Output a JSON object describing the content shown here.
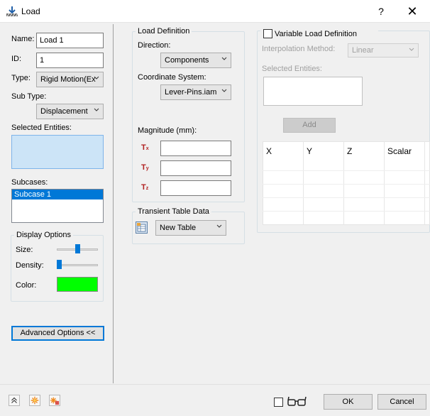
{
  "window": {
    "title": "Load",
    "help_label": "?",
    "close_label": "✕"
  },
  "left": {
    "name_label": "Name:",
    "name_value": "Load 1",
    "id_label": "ID:",
    "id_value": "1",
    "type_label": "Type:",
    "type_value": "Rigid Motion(Ex",
    "subtype_label": "Sub Type:",
    "subtype_value": "Displacement",
    "selected_entities_label": "Selected Entities:",
    "subcases_label": "Subcases:",
    "subcases": [
      "Subcase 1"
    ],
    "display_options": {
      "title": "Display Options",
      "size_label": "Size:",
      "size_level": 0.5,
      "density_label": "Density:",
      "density_level": 0.0,
      "color_label": "Color:",
      "color_value": "#00ff00"
    },
    "advanced_button": "Advanced Options <<"
  },
  "load_definition": {
    "title": "Load Definition",
    "direction_label": "Direction:",
    "direction_value": "Components",
    "coord_label": "Coordinate System:",
    "coord_value": "Lever-Pins.iam",
    "magnitude_label": "Magnitude (mm):",
    "components": [
      {
        "main": "T",
        "sub": "x",
        "value": ""
      },
      {
        "main": "T",
        "sub": "y",
        "value": ""
      },
      {
        "main": "T",
        "sub": "z",
        "value": ""
      }
    ]
  },
  "transient": {
    "title": "Transient Table Data",
    "table_value": "New Table"
  },
  "variable": {
    "title": "Variable Load Definition",
    "interp_label": "Interpolation Method:",
    "interp_value": "Linear",
    "selected_label": "Selected Entities:",
    "add_button": "Add",
    "columns": [
      "X",
      "Y",
      "Z",
      "Scalar"
    ]
  },
  "footer": {
    "ok": "OK",
    "cancel": "Cancel"
  },
  "icons": {
    "title": "load-icon",
    "expand": "double-chevron-up-icon",
    "add_star": "star-icon",
    "remove_star": "star-remove-icon",
    "glasses": "glasses-icon",
    "table": "table-icon"
  }
}
